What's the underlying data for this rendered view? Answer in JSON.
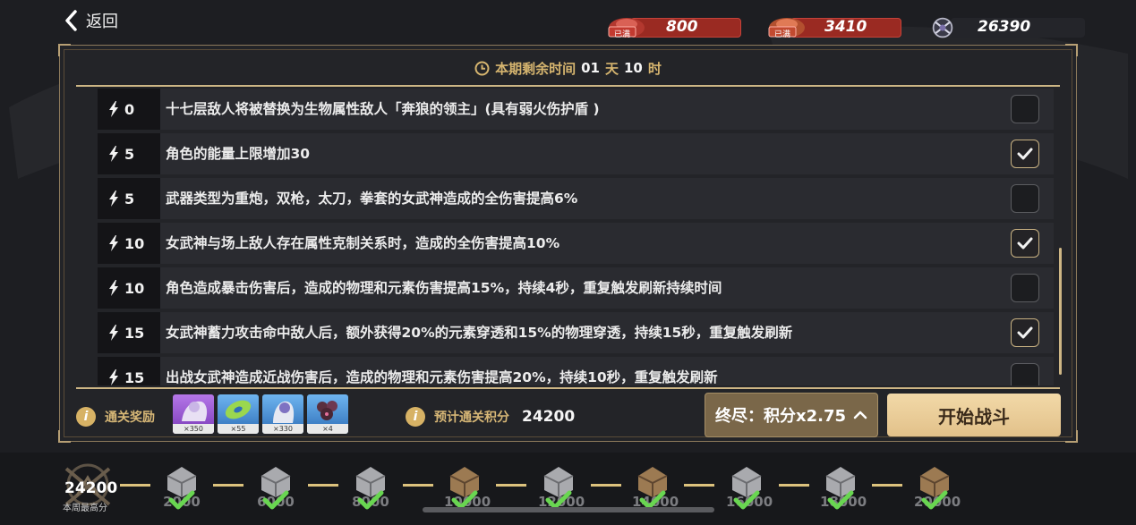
{
  "header": {
    "back_label": "返回",
    "currencies": [
      {
        "tag": "已满",
        "value": "800",
        "icon": "gem-icon",
        "color": "#9a2a22"
      },
      {
        "tag": "已满",
        "value": "3410",
        "icon": "gem-icon",
        "color": "#9a2a22"
      },
      {
        "value": "26390",
        "icon": "emblem-icon"
      }
    ]
  },
  "panel": {
    "timer_label": "本期剩余时间",
    "timer_days": "01",
    "timer_days_unit": "天",
    "timer_hours": "10",
    "timer_hours_unit": "时"
  },
  "rows": [
    {
      "cost": "0",
      "text": "十七层敌人将被替换为生物属性敌人「奔狼的领主」(具有弱火伤护盾 )",
      "checked": false
    },
    {
      "cost": "5",
      "text": "角色的能量上限增加30",
      "checked": true
    },
    {
      "cost": "5",
      "text": "武器类型为重炮，双枪，太刀，拳套的女武神造成的全伤害提高6%",
      "checked": false
    },
    {
      "cost": "10",
      "text": "女武神与场上敌人存在属性克制关系时，造成的全伤害提高10%",
      "checked": true
    },
    {
      "cost": "10",
      "text": "角色造成暴击伤害后，造成的物理和元素伤害提高15%，持续4秒，重复触发刷新持续时间",
      "checked": false
    },
    {
      "cost": "15",
      "text": "女武神蓄力攻击命中敌人后，额外获得20%的元素穿透和15%的物理穿透，持续15秒，重复触发刷新",
      "checked": true
    },
    {
      "cost": "15",
      "text": "出战女武神造成近战伤害后，造成的物理和元素伤害提高20%，持续10秒，重复触发刷新",
      "checked": false
    }
  ],
  "footer": {
    "reward_label": "通关奖励",
    "rewards": [
      {
        "qty": "×350",
        "icon": "character-card-icon",
        "color": "#8a3fc6"
      },
      {
        "qty": "×55",
        "icon": "disc-icon",
        "color": "#3a86d0"
      },
      {
        "qty": "×330",
        "icon": "character-card-icon",
        "color": "#3a86d0"
      },
      {
        "qty": "×4",
        "icon": "crystal-cluster-icon",
        "color": "#3a86d0"
      }
    ],
    "estimate_label": "预计通关积分",
    "estimate_value": "24200",
    "difficulty_label": "终尽：积分x2.75",
    "start_label": "开始战斗"
  },
  "progress": {
    "best_score": "24200",
    "best_label": "本周最高分",
    "milestones": [
      {
        "value": "2000",
        "tier": "silver",
        "done": true
      },
      {
        "value": "6000",
        "tier": "silver",
        "done": true
      },
      {
        "value": "8000",
        "tier": "silver",
        "done": true
      },
      {
        "value": "10000",
        "tier": "bronze",
        "done": true
      },
      {
        "value": "12000",
        "tier": "silver",
        "done": true
      },
      {
        "value": "14000",
        "tier": "bronze",
        "done": true
      },
      {
        "value": "16000",
        "tier": "silver",
        "done": true
      },
      {
        "value": "18000",
        "tier": "silver",
        "done": true
      },
      {
        "value": "20000",
        "tier": "bronze",
        "done": true
      }
    ]
  },
  "colors": {
    "accent_gold": "#d7b776",
    "panel_border": "#8d7a5b",
    "check_green": "#69d651",
    "start_button": "#e9cb95"
  }
}
